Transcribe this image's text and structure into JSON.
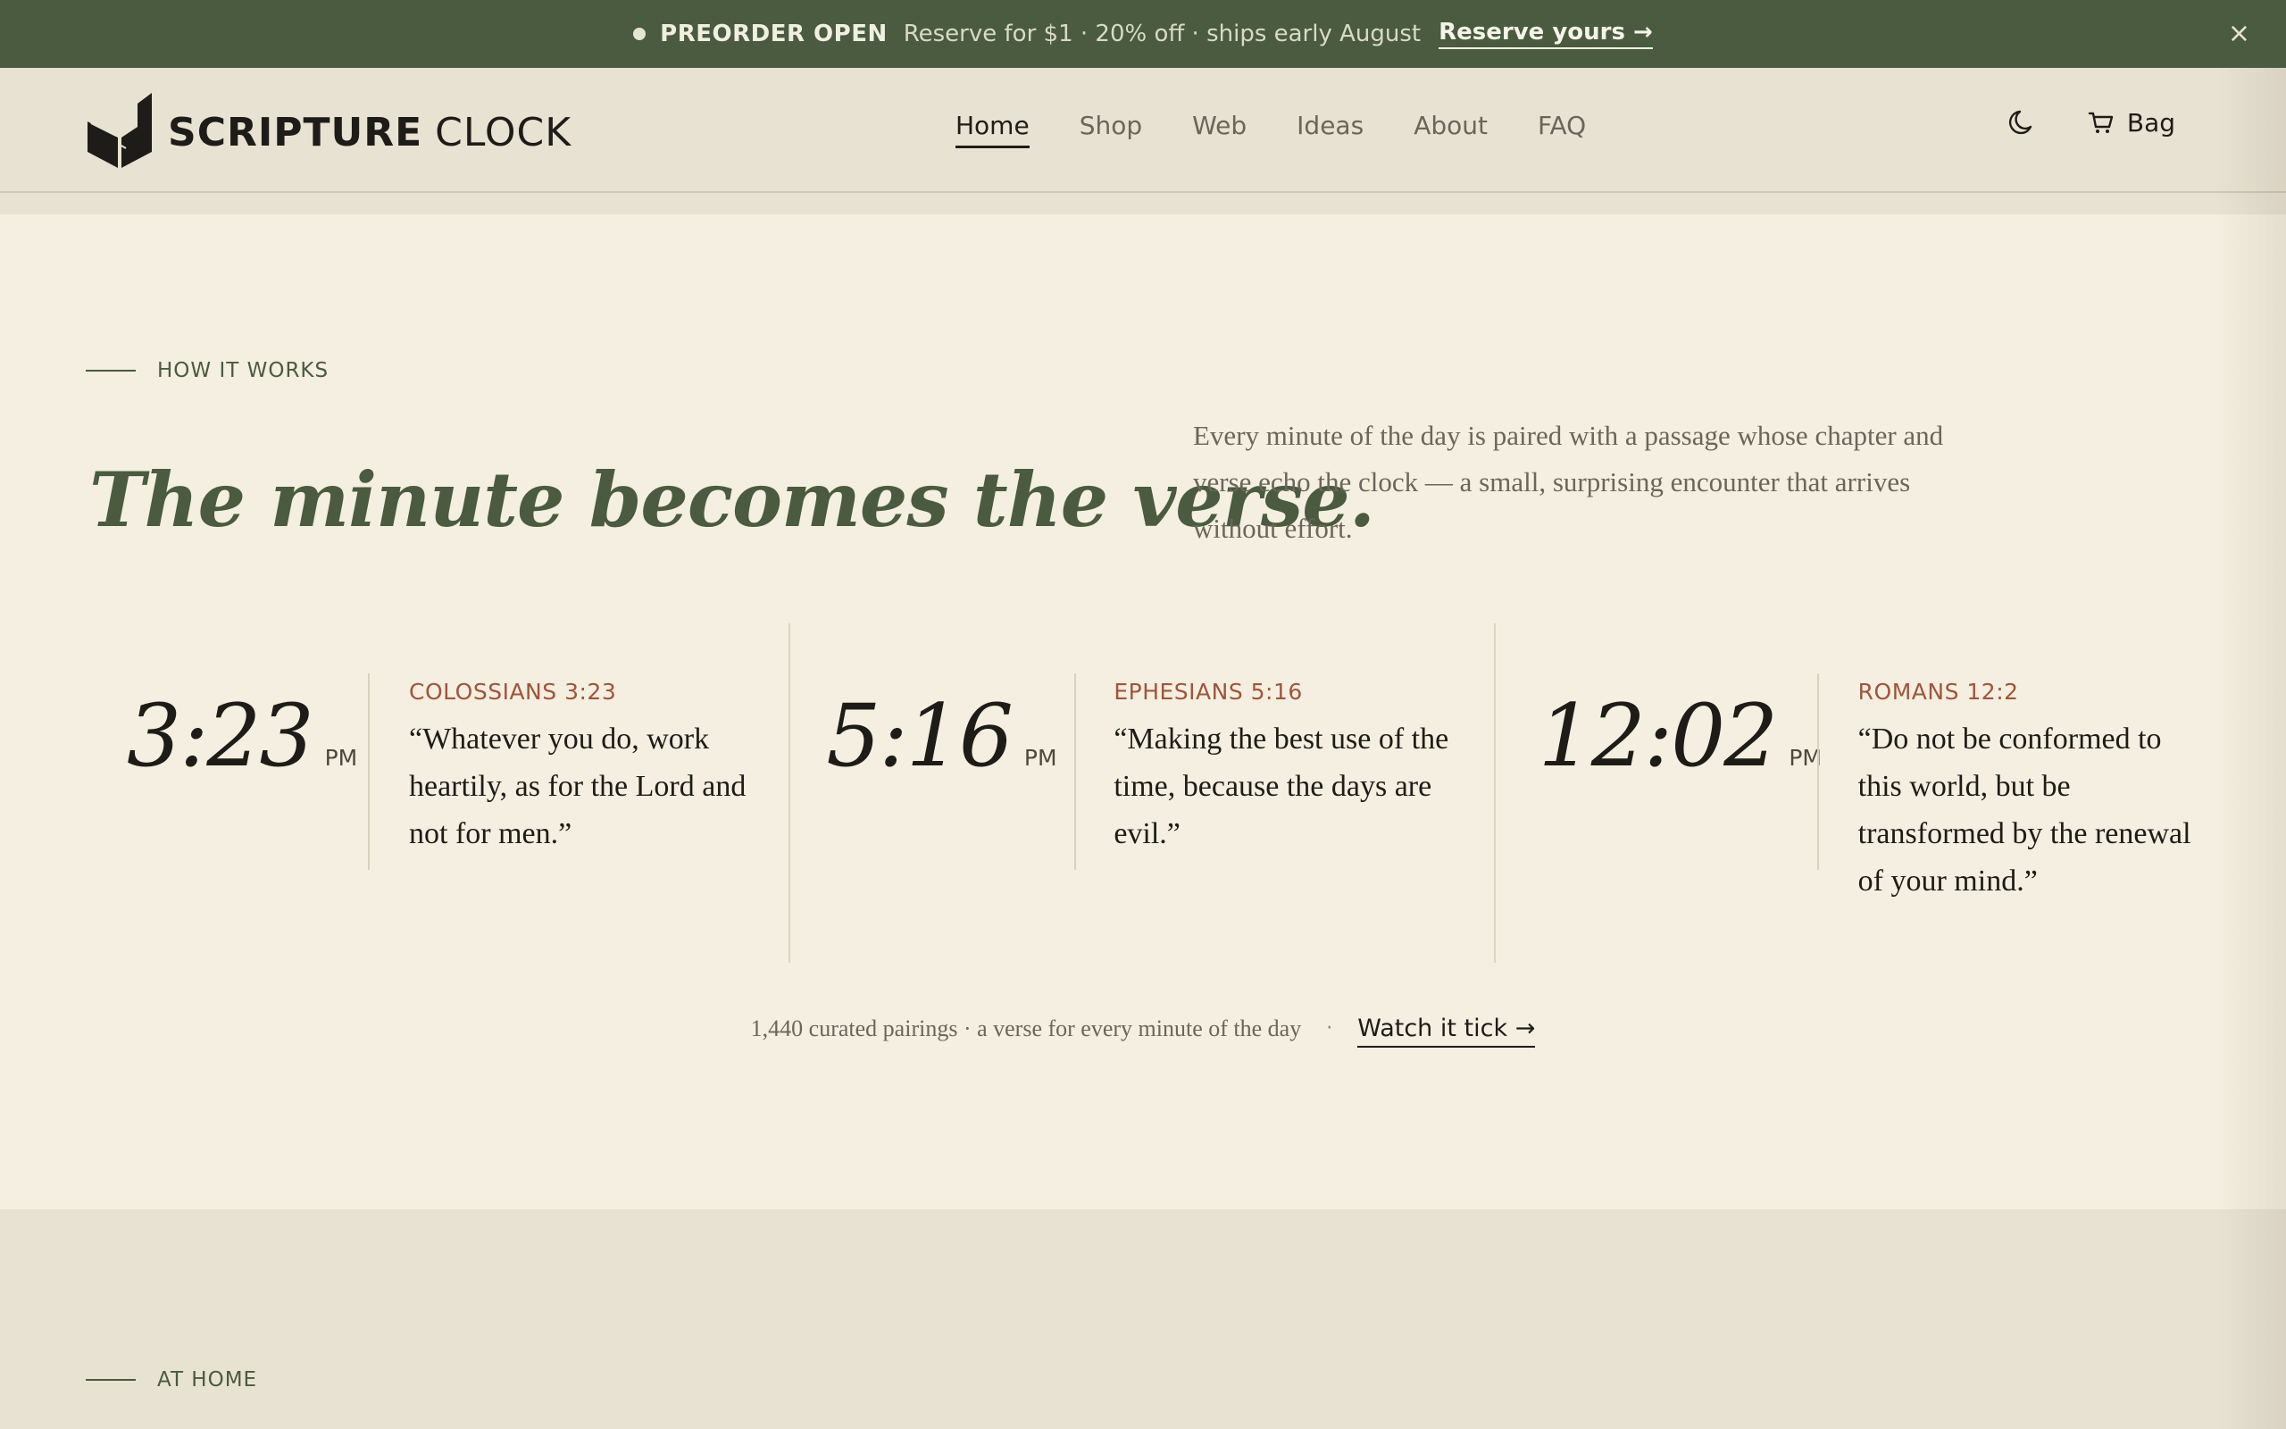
{
  "announcement": {
    "badge": "PREORDER OPEN",
    "message": "Reserve for $1 · 20% off · ships early August",
    "cta": "Reserve yours →",
    "close": "×"
  },
  "brand": {
    "name_bold": "SCRIPTURE",
    "name_light": "CLOCK",
    "logo_icon": "book-clock-icon"
  },
  "nav": {
    "items": [
      {
        "label": "Home",
        "active": true
      },
      {
        "label": "Shop"
      },
      {
        "label": "Web"
      },
      {
        "label": "Ideas"
      },
      {
        "label": "About"
      },
      {
        "label": "FAQ"
      }
    ]
  },
  "header_actions": {
    "theme_icon": "moon-icon",
    "bag_icon": "cart-icon",
    "bag_label": "Bag"
  },
  "how_it_works": {
    "eyebrow": "HOW IT WORKS",
    "headline": "The minute becomes the verse.",
    "intro": "Every minute of the day is paired with a passage whose chapter and verse echo the clock — a small, surprising encounter that arrives without effort.",
    "pairings": [
      {
        "time": "3:23",
        "ampm": "PM",
        "reference": "COLOSSIANS 3:23",
        "quote": "“Whatever you do, work heartily, as for the Lord and not for men.”"
      },
      {
        "time": "5:16",
        "ampm": "PM",
        "reference": "EPHESIANS 5:16",
        "quote": "“Making the best use of the time, because the days are evil.”"
      },
      {
        "time": "12:02",
        "ampm": "PM",
        "reference": "ROMANS 12:2",
        "quote": "“Do not be conformed to this world, but be transformed by the renewal of your mind.”"
      }
    ],
    "footnote": "1,440 curated pairings · a verse for every minute of the day",
    "footnote_sep": "·",
    "watch_cta": "Watch it tick →"
  },
  "at_home": {
    "eyebrow": "AT HOME"
  },
  "colors": {
    "green": "#4a5b3f",
    "accent_rust": "#a0553a",
    "cream": "#f4efe0",
    "sand": "#e8e2d3"
  }
}
